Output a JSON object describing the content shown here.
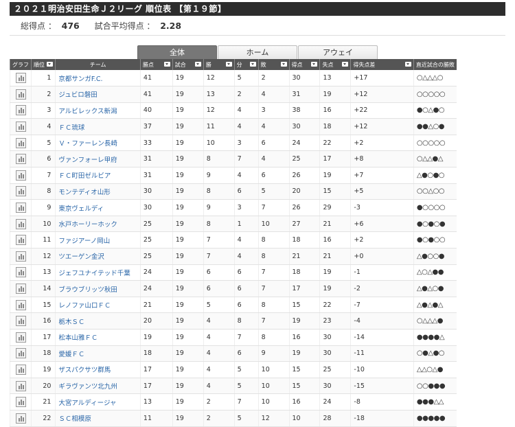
{
  "title": "２０２１明治安田生命Ｊ２リーグ 順位表 【第１９節】",
  "summary": {
    "total_label": "総得点 ：",
    "total_value": "476",
    "avg_label": "試合平均得点 ：",
    "avg_value": "2.28"
  },
  "tabs": [
    {
      "label": "全体",
      "active": true
    },
    {
      "label": "ホーム",
      "active": false
    },
    {
      "label": "アウェイ",
      "active": false
    }
  ],
  "columns": {
    "graph": "グラフ",
    "rank": "順位",
    "team": "チーム",
    "points": "勝点",
    "played": "試合",
    "win": "勝",
    "draw": "分",
    "loss": "敗",
    "gf": "得点",
    "ga": "失点",
    "gd": "得失点差",
    "recent": "直近試合の勝敗"
  },
  "rows": [
    {
      "rank": "1",
      "team": "京都サンガF.C.",
      "points": "41",
      "played": "19",
      "win": "12",
      "draw": "5",
      "loss": "2",
      "gf": "30",
      "ga": "13",
      "gd": "+17",
      "recent": "○△△△○"
    },
    {
      "rank": "2",
      "team": "ジュビロ磐田",
      "points": "41",
      "played": "19",
      "win": "13",
      "draw": "2",
      "loss": "4",
      "gf": "31",
      "ga": "19",
      "gd": "+12",
      "recent": "○○○○○"
    },
    {
      "rank": "3",
      "team": "アルビレックス新潟",
      "points": "40",
      "played": "19",
      "win": "12",
      "draw": "4",
      "loss": "3",
      "gf": "38",
      "ga": "16",
      "gd": "+22",
      "recent": "●○△●○"
    },
    {
      "rank": "4",
      "team": "ＦＣ琉球",
      "points": "37",
      "played": "19",
      "win": "11",
      "draw": "4",
      "loss": "4",
      "gf": "30",
      "ga": "18",
      "gd": "+12",
      "recent": "●●△○●"
    },
    {
      "rank": "5",
      "team": "Ｖ・ファーレン長崎",
      "points": "33",
      "played": "19",
      "win": "10",
      "draw": "3",
      "loss": "6",
      "gf": "24",
      "ga": "22",
      "gd": "+2",
      "recent": "○○○○○"
    },
    {
      "rank": "6",
      "team": "ヴァンフォーレ甲府",
      "points": "31",
      "played": "19",
      "win": "8",
      "draw": "7",
      "loss": "4",
      "gf": "25",
      "ga": "17",
      "gd": "+8",
      "recent": "○△△●△"
    },
    {
      "rank": "7",
      "team": "ＦＣ町田ゼルビア",
      "points": "31",
      "played": "19",
      "win": "9",
      "draw": "4",
      "loss": "6",
      "gf": "26",
      "ga": "19",
      "gd": "+7",
      "recent": "△●○●○"
    },
    {
      "rank": "8",
      "team": "モンテディオ山形",
      "points": "30",
      "played": "19",
      "win": "8",
      "draw": "6",
      "loss": "5",
      "gf": "20",
      "ga": "15",
      "gd": "+5",
      "recent": "○○△○○"
    },
    {
      "rank": "9",
      "team": "東京ヴェルディ",
      "points": "30",
      "played": "19",
      "win": "9",
      "draw": "3",
      "loss": "7",
      "gf": "26",
      "ga": "29",
      "gd": "-3",
      "recent": "●○○○○"
    },
    {
      "rank": "10",
      "team": "水戸ホーリーホック",
      "points": "25",
      "played": "19",
      "win": "8",
      "draw": "1",
      "loss": "10",
      "gf": "27",
      "ga": "21",
      "gd": "+6",
      "recent": "●○●○●"
    },
    {
      "rank": "11",
      "team": "ファジアーノ岡山",
      "points": "25",
      "played": "19",
      "win": "7",
      "draw": "4",
      "loss": "8",
      "gf": "18",
      "ga": "16",
      "gd": "+2",
      "recent": "●○●○○"
    },
    {
      "rank": "12",
      "team": "ツエーゲン金沢",
      "points": "25",
      "played": "19",
      "win": "7",
      "draw": "4",
      "loss": "8",
      "gf": "21",
      "ga": "21",
      "gd": "+0",
      "recent": "△●○○●"
    },
    {
      "rank": "13",
      "team": "ジェフユナイテッド千葉",
      "points": "24",
      "played": "19",
      "win": "6",
      "draw": "6",
      "loss": "7",
      "gf": "18",
      "ga": "19",
      "gd": "-1",
      "recent": "△○△●●"
    },
    {
      "rank": "14",
      "team": "ブラウブリッツ秋田",
      "points": "24",
      "played": "19",
      "win": "6",
      "draw": "6",
      "loss": "7",
      "gf": "17",
      "ga": "19",
      "gd": "-2",
      "recent": "△●△○●"
    },
    {
      "rank": "15",
      "team": "レノファ山口ＦＣ",
      "points": "21",
      "played": "19",
      "win": "5",
      "draw": "6",
      "loss": "8",
      "gf": "15",
      "ga": "22",
      "gd": "-7",
      "recent": "△●△●△"
    },
    {
      "rank": "16",
      "team": "栃木ＳＣ",
      "points": "20",
      "played": "19",
      "win": "4",
      "draw": "8",
      "loss": "7",
      "gf": "19",
      "ga": "23",
      "gd": "-4",
      "recent": "○△△△●"
    },
    {
      "rank": "17",
      "team": "松本山雅ＦＣ",
      "points": "19",
      "played": "19",
      "win": "4",
      "draw": "7",
      "loss": "8",
      "gf": "16",
      "ga": "30",
      "gd": "-14",
      "recent": "●●●●△"
    },
    {
      "rank": "18",
      "team": "愛媛ＦＣ",
      "points": "18",
      "played": "19",
      "win": "4",
      "draw": "6",
      "loss": "9",
      "gf": "19",
      "ga": "30",
      "gd": "-11",
      "recent": "○●△●○"
    },
    {
      "rank": "19",
      "team": "ザスパクサツ群馬",
      "points": "17",
      "played": "19",
      "win": "4",
      "draw": "5",
      "loss": "10",
      "gf": "15",
      "ga": "25",
      "gd": "-10",
      "recent": "△△○△●"
    },
    {
      "rank": "20",
      "team": "ギラヴァンツ北九州",
      "points": "17",
      "played": "19",
      "win": "4",
      "draw": "5",
      "loss": "10",
      "gf": "15",
      "ga": "30",
      "gd": "-15",
      "recent": "○○●●●"
    },
    {
      "rank": "21",
      "team": "大宮アルディージャ",
      "points": "13",
      "played": "19",
      "win": "2",
      "draw": "7",
      "loss": "10",
      "gf": "16",
      "ga": "24",
      "gd": "-8",
      "recent": "●●●△△"
    },
    {
      "rank": "22",
      "team": "ＳＣ相模原",
      "points": "11",
      "played": "19",
      "win": "2",
      "draw": "5",
      "loss": "12",
      "gf": "10",
      "ga": "28",
      "gd": "-18",
      "recent": "●●●●●"
    }
  ]
}
